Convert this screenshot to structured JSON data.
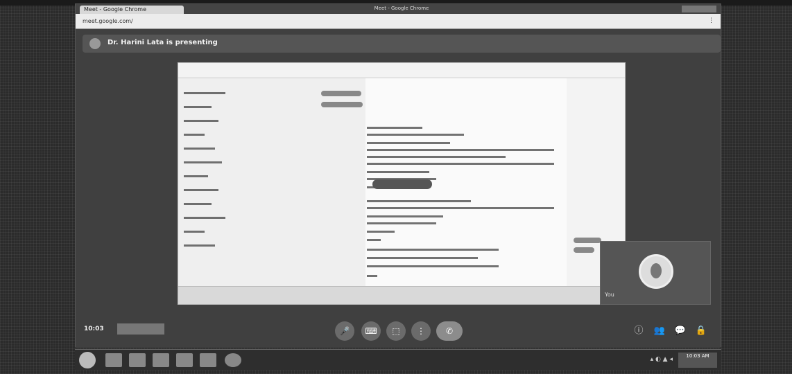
{
  "browser": {
    "tab_title": "Meet - Google Chrome",
    "window_title": "Meet - Google Chrome",
    "url": "meet.google.com/",
    "menu_glyph": "⋮"
  },
  "meet": {
    "presenter_text": "Dr. Harini Lata is presenting",
    "meeting_code": "10:03",
    "meeting_id": "",
    "controls": {
      "mic_icon": "🎤",
      "cam_icon": "⌨",
      "present_icon": "⬚",
      "more_icon": "⋮",
      "end_icon": "✆",
      "tooltip": ""
    },
    "self_name": "You",
    "right_controls": [
      "ⓘ",
      "👥",
      "💬",
      "🔒"
    ]
  },
  "taskbar": {
    "tray_text": "▴ ◐ ▲ ◂",
    "time": "10:03 AM",
    "date": ""
  },
  "colors": {
    "accent": "#5a5a5a",
    "stage": "#404040"
  }
}
